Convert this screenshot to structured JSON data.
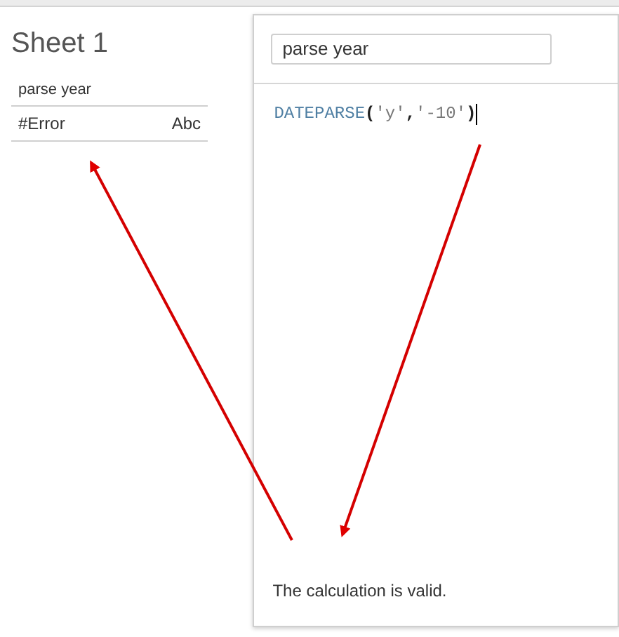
{
  "sheet": {
    "title": "Sheet 1",
    "column_header": "parse year",
    "rows": [
      {
        "value": "#Error",
        "type": "Abc"
      }
    ]
  },
  "calc_dialog": {
    "name_field": {
      "value": "parse year"
    },
    "formula": [
      {
        "kind": "function",
        "text": "DATEPARSE"
      },
      {
        "kind": "punct",
        "text": "("
      },
      {
        "kind": "string",
        "text": "'y'"
      },
      {
        "kind": "punct",
        "text": ","
      },
      {
        "kind": "string",
        "text": "'-10'"
      },
      {
        "kind": "punct",
        "text": ")"
      }
    ],
    "status": "The calculation is valid."
  }
}
